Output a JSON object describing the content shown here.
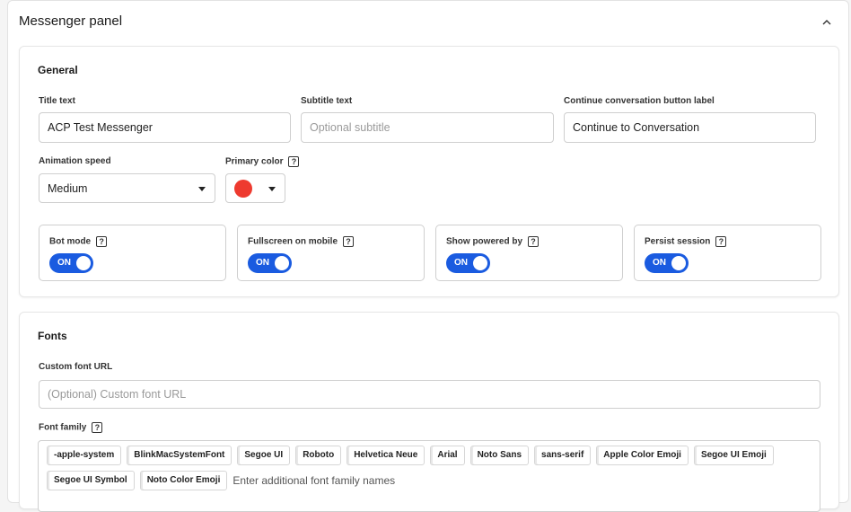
{
  "panel": {
    "title": "Messenger panel"
  },
  "general": {
    "title": "General",
    "title_text": {
      "label": "Title text",
      "value": "ACP Test Messenger",
      "placeholder": ""
    },
    "subtitle_text": {
      "label": "Subtitle text",
      "value": "",
      "placeholder": "Optional subtitle"
    },
    "continue_label": {
      "label": "Continue conversation button label",
      "value": "Continue to Conversation",
      "placeholder": ""
    },
    "animation_speed": {
      "label": "Animation speed",
      "selected": "Medium"
    },
    "primary_color": {
      "label": "Primary color",
      "help": "?",
      "color": "#ee3a2f"
    },
    "toggles": [
      {
        "label": "Bot mode",
        "help": "?",
        "state": "ON"
      },
      {
        "label": "Fullscreen on mobile",
        "help": "?",
        "state": "ON"
      },
      {
        "label": "Show powered by",
        "help": "?",
        "state": "ON"
      },
      {
        "label": "Persist session",
        "help": "?",
        "state": "ON"
      }
    ],
    "toggle_color": "#1a5be0"
  },
  "fonts": {
    "title": "Fonts",
    "custom_url": {
      "label": "Custom font URL",
      "value": "",
      "placeholder": "(Optional) Custom font URL"
    },
    "font_family": {
      "label": "Font family",
      "help": "?",
      "tags": [
        "-apple-system",
        "BlinkMacSystemFont",
        "Segoe UI",
        "Roboto",
        "Helvetica Neue",
        "Arial",
        "Noto Sans",
        "sans-serif",
        "Apple Color Emoji",
        "Segoe UI Emoji",
        "Segoe UI Symbol",
        "Noto Color Emoji"
      ],
      "input_placeholder": "Enter additional font family names"
    }
  },
  "icons": {
    "collapse": "chevron-up-icon",
    "dropdown": "caret-down-icon",
    "help": "help-icon"
  }
}
